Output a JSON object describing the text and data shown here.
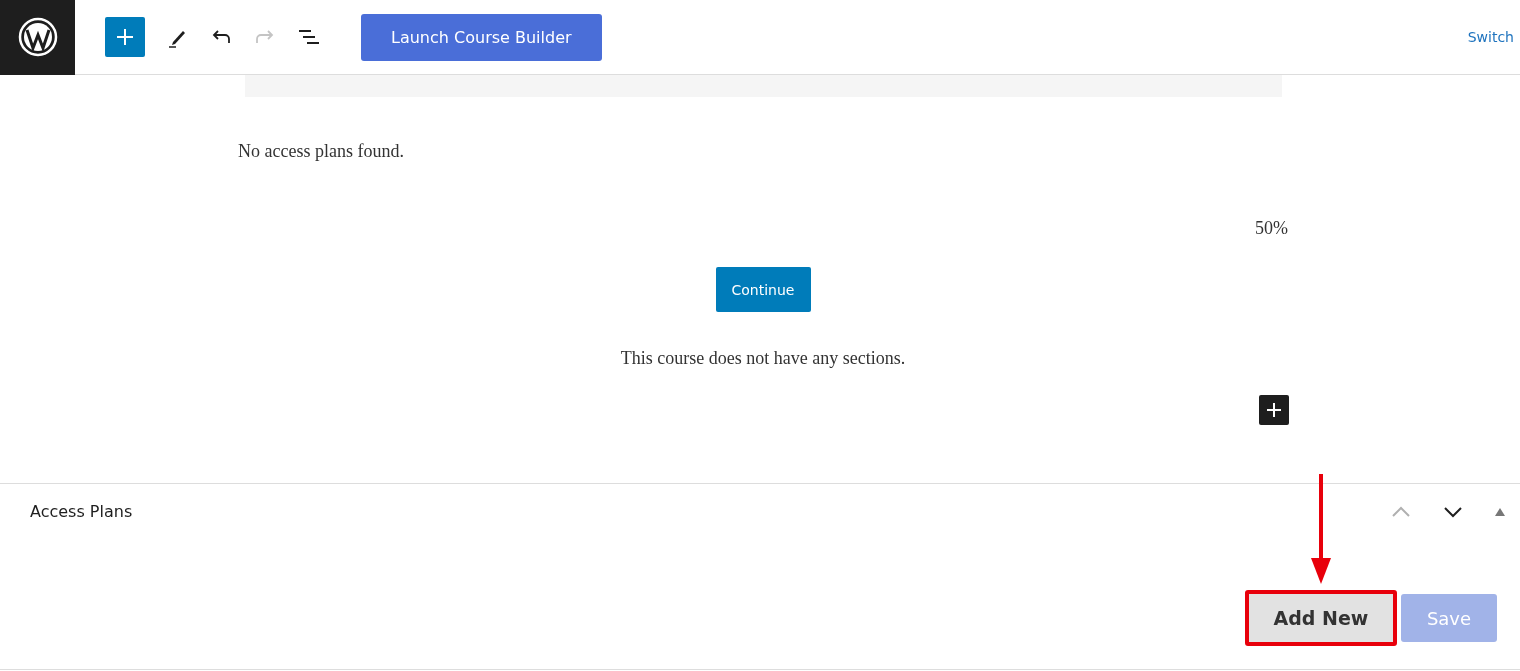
{
  "toolbar": {
    "launch_button": "Launch Course Builder",
    "switch_link": "Switch",
    "redo_disabled": true
  },
  "content": {
    "empty_plans": "No access plans found.",
    "progress": "50%",
    "continue_button": "Continue",
    "empty_sections": "This course does not have any sections."
  },
  "panel": {
    "title": "Access Plans",
    "move_up_disabled": true,
    "add_button": "Add New",
    "save_button": "Save",
    "save_disabled": true
  }
}
